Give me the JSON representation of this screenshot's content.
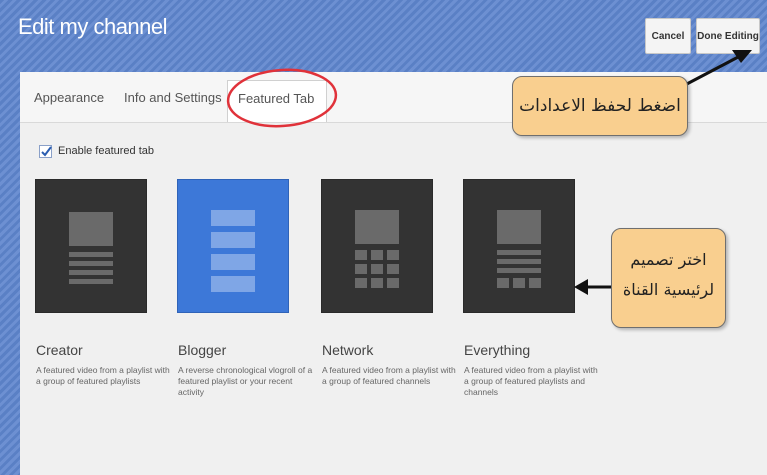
{
  "header": {
    "title": "Edit my channel",
    "cancel_label": "Cancel",
    "done_label": "Done Editing"
  },
  "tabs": [
    {
      "label": "Appearance"
    },
    {
      "label": "Info and Settings"
    },
    {
      "label": "Featured Tab",
      "active": true
    }
  ],
  "enable_featured": {
    "label": "Enable featured tab",
    "checked": true
  },
  "layouts": [
    {
      "name": "Creator",
      "description": "A featured video from a playlist with a group of featured playlists",
      "selected": false
    },
    {
      "name": "Blogger",
      "description": "A reverse chronological vlogroll of a featured playlist or your recent activity",
      "selected": true
    },
    {
      "name": "Network",
      "description": "A featured video from a playlist with a group of featured channels",
      "selected": false
    },
    {
      "name": "Everything",
      "description": "A featured video from a playlist with a group of featured playlists and channels",
      "selected": false
    }
  ],
  "annotations": {
    "save_note": "اضغط لحفظ الاعدادات",
    "layout_note_line1": "اختر تصميم",
    "layout_note_line2": "لرئيسية القناة"
  },
  "colors": {
    "header_bg": "#5a80c5",
    "selected_card": "#3d78d8",
    "card_bg": "#333333",
    "annotation_bg": "#f9cf8f",
    "highlight_circle": "#e0323a"
  }
}
